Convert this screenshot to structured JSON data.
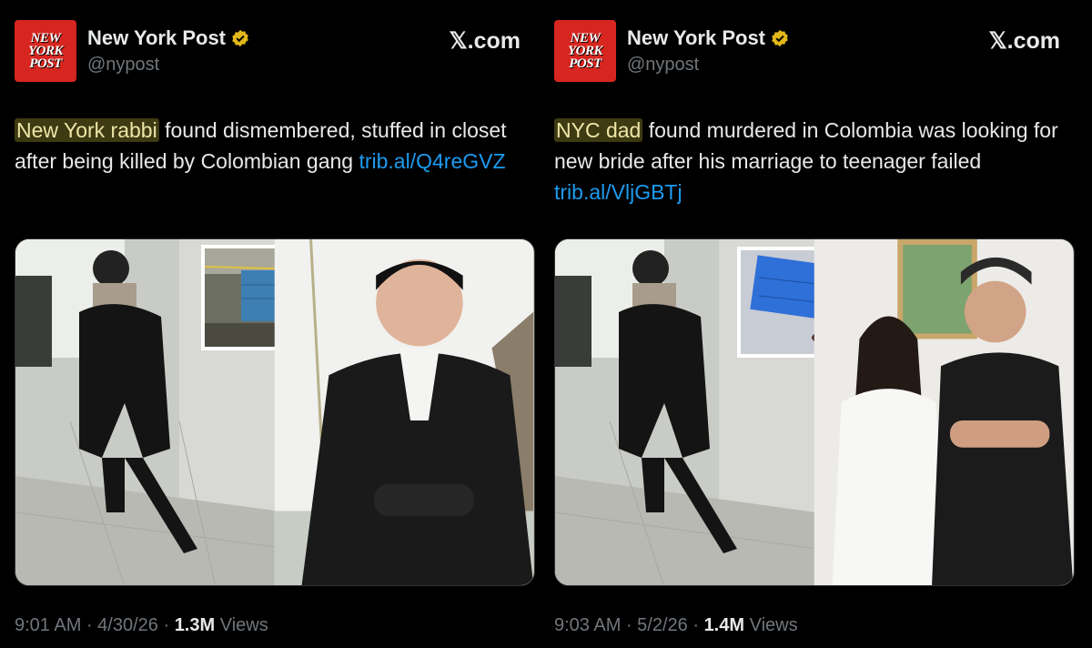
{
  "tweets": [
    {
      "logo_lines": [
        "NEW",
        "YORK",
        "POST"
      ],
      "account_name": "New York Post",
      "handle": "@nypost",
      "site": "𝕏.com",
      "text_highlight": "New York rabbi",
      "text_rest": " found dismembered, stuffed in closet after being killed by Colombian gang ",
      "link": "trib.al/Q4reGVZ",
      "time": "9:01 AM",
      "date": "4/30/26",
      "views_count": "1.3M",
      "views_label": "Views"
    },
    {
      "logo_lines": [
        "NEW",
        "YORK",
        "POST"
      ],
      "account_name": "New York Post",
      "handle": "@nypost",
      "site": "𝕏.com",
      "text_highlight": "NYC dad",
      "text_rest": " found murdered in Colombia was looking for new bride after his marriage to teenager failed ",
      "link": "trib.al/VljGBTj",
      "time": "9:03 AM",
      "date": "5/2/26",
      "views_count": "1.4M",
      "views_label": "Views"
    }
  ],
  "footer_separator": " · ",
  "colors": {
    "background": "#000000",
    "link": "#1d9bf0",
    "highlight_bg": "#3e3a12",
    "logo_red": "#d6261f",
    "verified_gold": "#e2b719"
  }
}
